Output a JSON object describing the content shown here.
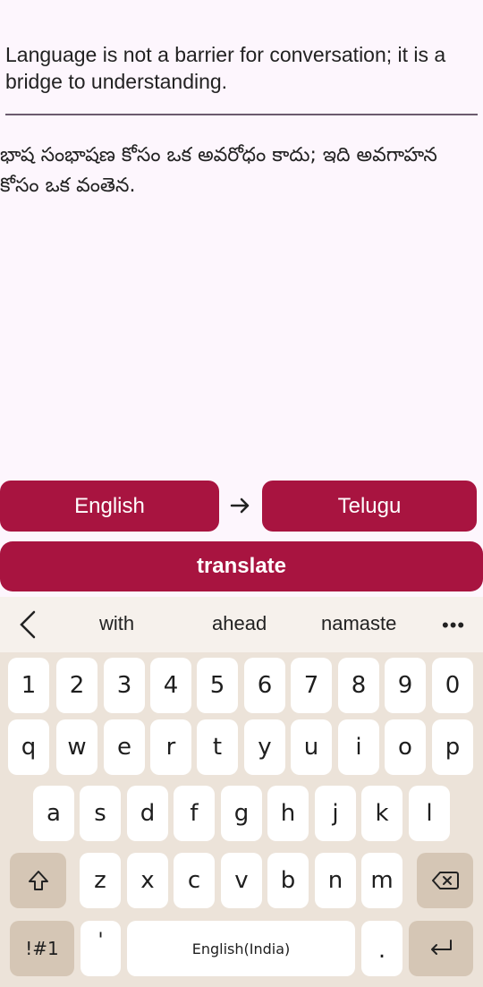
{
  "content": {
    "source_text": "Language is not a barrier for conversation; it is a bridge to understanding.",
    "translated_text": "భాష సంభాషణ కోసం ఒక అవరోధం కాదు; ఇది అవగాహన కోసం ఒక వంతెన."
  },
  "controls": {
    "source_language": "English",
    "target_language": "Telugu",
    "translate_label": "translate",
    "arrow_icon": "arrow-right-icon"
  },
  "keyboard": {
    "suggestions": [
      "with",
      "ahead",
      "namaste"
    ],
    "more_label": "•••",
    "number_row": [
      "1",
      "2",
      "3",
      "4",
      "5",
      "6",
      "7",
      "8",
      "9",
      "0"
    ],
    "row1": [
      "q",
      "w",
      "e",
      "r",
      "t",
      "y",
      "u",
      "i",
      "o",
      "p"
    ],
    "row2": [
      "a",
      "s",
      "d",
      "f",
      "g",
      "h",
      "j",
      "k",
      "l"
    ],
    "row3": [
      "z",
      "x",
      "c",
      "v",
      "b",
      "n",
      "m"
    ],
    "symbols_label": "!#1",
    "comma_label": "'",
    "space_label": "English(India)",
    "period_label": "."
  },
  "colors": {
    "accent": "#a81440",
    "background": "#fdf6fd",
    "keyboard_bg": "#ece3d9"
  }
}
